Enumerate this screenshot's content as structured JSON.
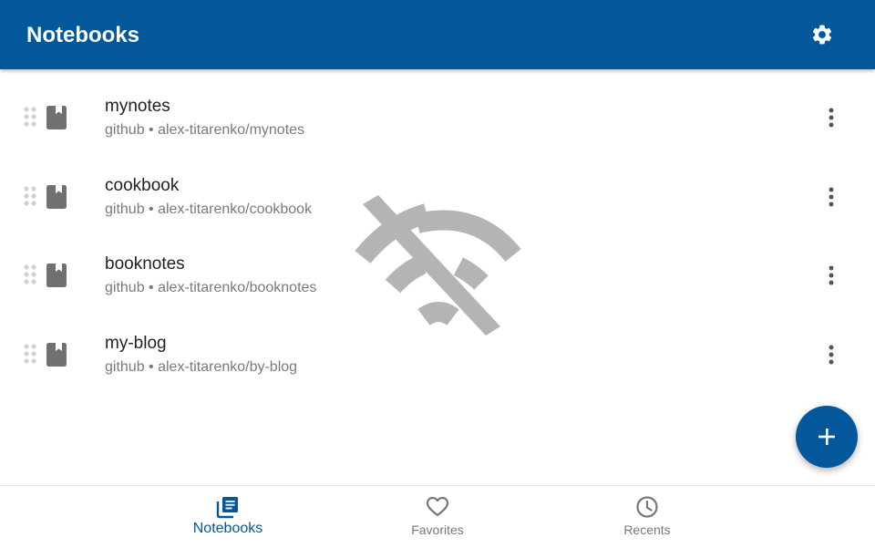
{
  "colors": {
    "primary": "#03589c",
    "icon_grey": "#707070",
    "offline_icon": "#b4b4b4",
    "inactive_nav": "#777777"
  },
  "app_bar": {
    "title": "Notebooks",
    "settings_icon": "gear-icon"
  },
  "notebooks": [
    {
      "name": "mynotes",
      "subtitle": "github • alex-titarenko/mynotes"
    },
    {
      "name": "cookbook",
      "subtitle": "github • alex-titarenko/cookbook"
    },
    {
      "name": "booknotes",
      "subtitle": "github • alex-titarenko/booknotes"
    },
    {
      "name": "my-blog",
      "subtitle": "github • alex-titarenko/by-blog"
    }
  ],
  "status": {
    "connectivity_icon": "wifi-off-icon"
  },
  "fab": {
    "icon": "plus-icon"
  },
  "bottom_nav": [
    {
      "label": "Notebooks",
      "icon": "notebooks-icon",
      "active": true
    },
    {
      "label": "Favorites",
      "icon": "heart-icon",
      "active": false
    },
    {
      "label": "Recents",
      "icon": "clock-icon",
      "active": false
    }
  ]
}
